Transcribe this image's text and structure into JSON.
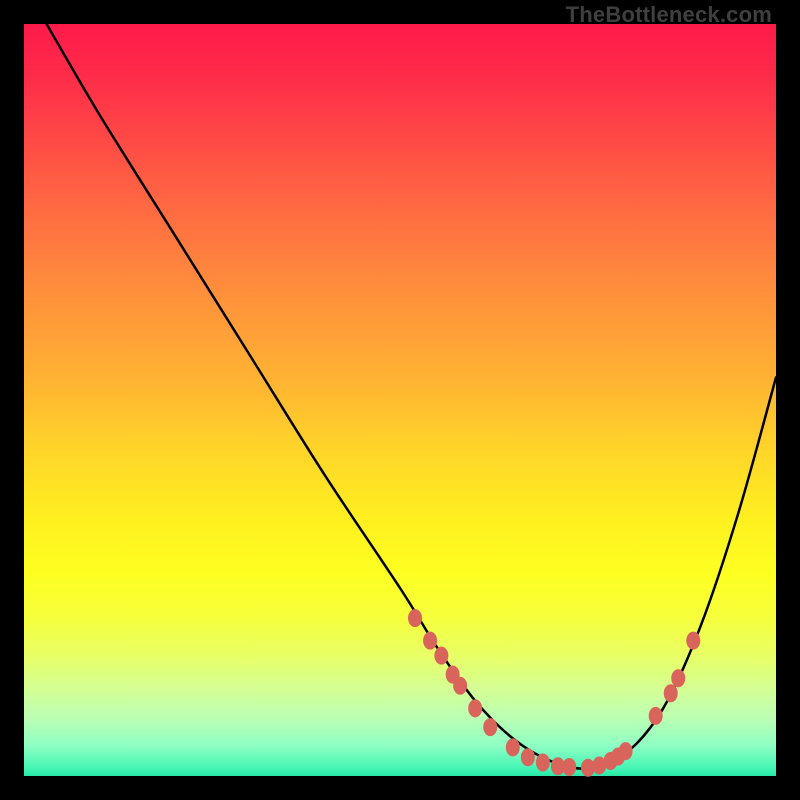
{
  "watermark": "TheBottleneck.com",
  "chart_data": {
    "type": "line",
    "title": "",
    "xlabel": "",
    "ylabel": "",
    "xlim": [
      0,
      100
    ],
    "ylim": [
      0,
      100
    ],
    "grid": false,
    "series": [
      {
        "name": "curve",
        "color": "#000000",
        "x": [
          3,
          10,
          20,
          30,
          40,
          50,
          55,
          60,
          65,
          70,
          75,
          80,
          85,
          90,
          95,
          100
        ],
        "y": [
          100,
          88,
          72,
          56,
          40,
          25,
          17,
          10,
          5,
          2,
          1,
          3,
          9,
          20,
          35,
          53
        ]
      }
    ],
    "marker_series": {
      "name": "points",
      "color": "#d9645b",
      "x": [
        52,
        54,
        55.5,
        57,
        58,
        60,
        62,
        65,
        67,
        69,
        71,
        72.5,
        75,
        76.5,
        78,
        79,
        80,
        84,
        86,
        87,
        89
      ],
      "y": [
        21,
        18,
        16,
        13.5,
        12,
        9,
        6.5,
        3.8,
        2.5,
        1.8,
        1.3,
        1.2,
        1.1,
        1.4,
        2,
        2.6,
        3.3,
        8,
        11,
        13,
        18
      ]
    }
  }
}
